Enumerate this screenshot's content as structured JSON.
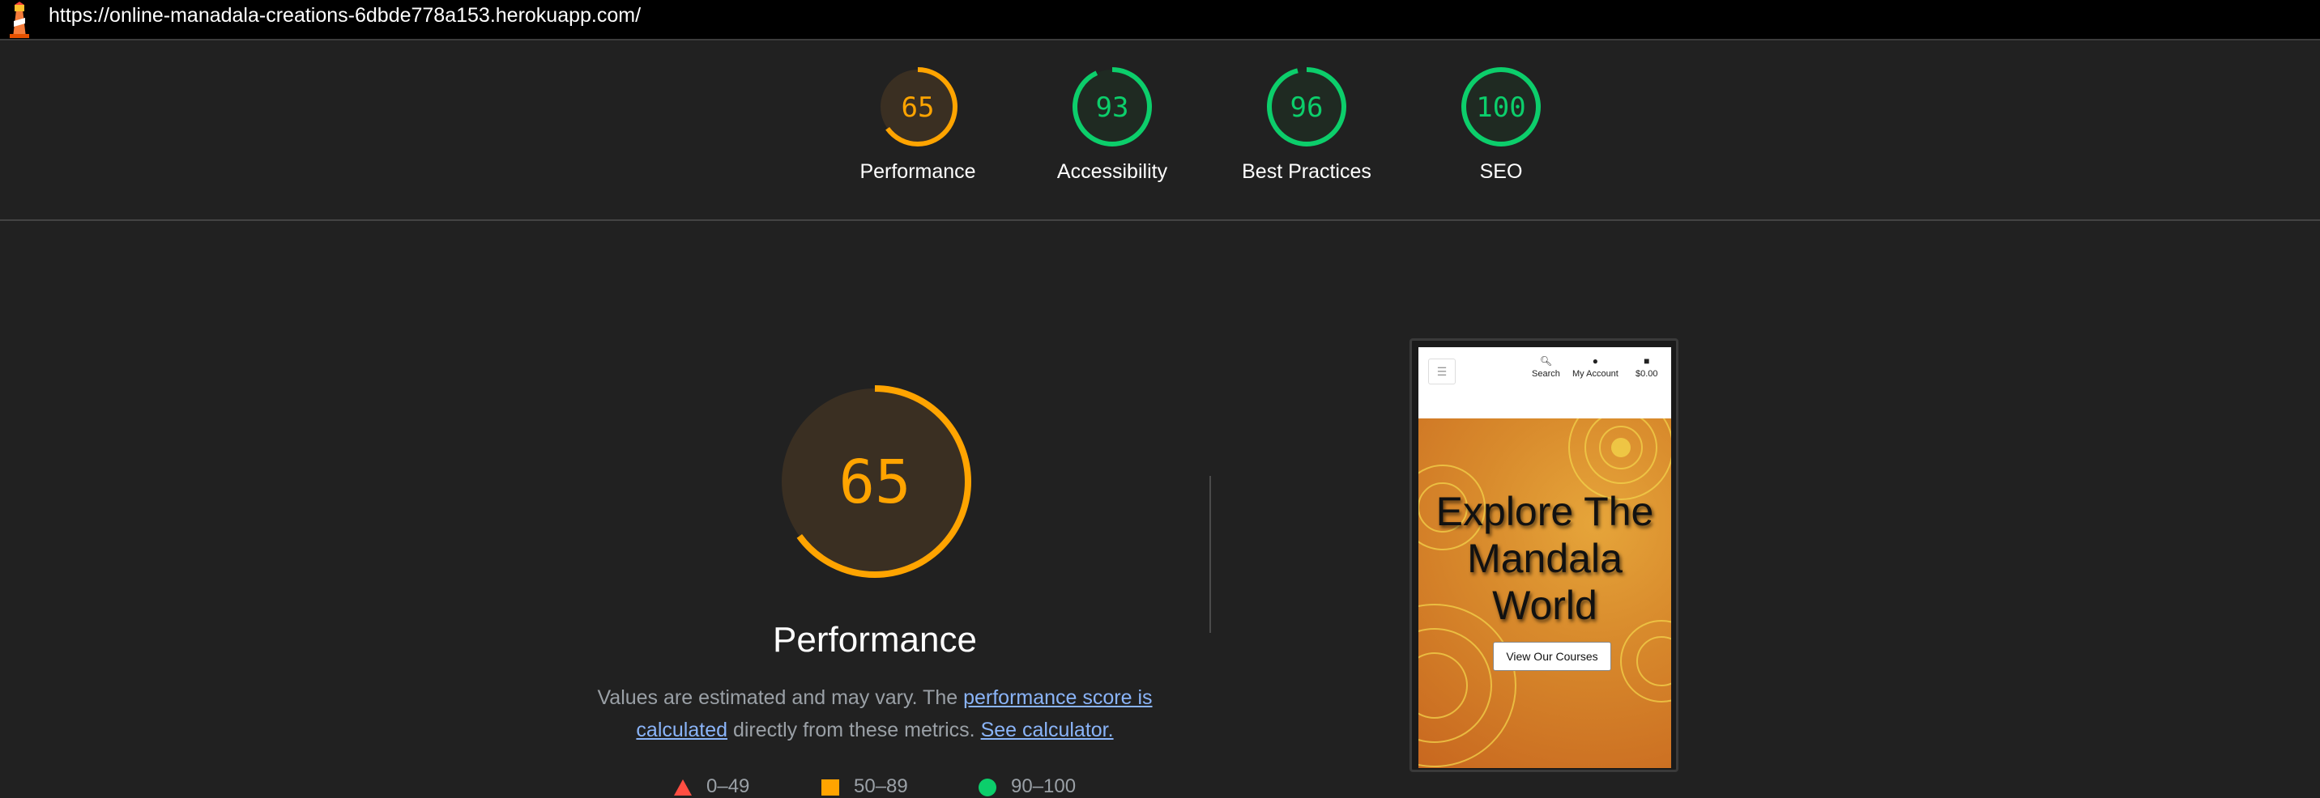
{
  "url_bar": {
    "url": "https://online-manadala-creations-6dbde778a153.herokuapp.com/"
  },
  "colors": {
    "average": "#ffa400",
    "pass": "#0cce6b",
    "fail": "#ff4e42"
  },
  "gauges": [
    {
      "label": "Performance",
      "score": "65",
      "fraction": 0.65,
      "status": "average"
    },
    {
      "label": "Accessibility",
      "score": "93",
      "fraction": 0.93,
      "status": "pass"
    },
    {
      "label": "Best Practices",
      "score": "96",
      "fraction": 0.96,
      "status": "pass"
    },
    {
      "label": "SEO",
      "score": "100",
      "fraction": 1.0,
      "status": "pass"
    }
  ],
  "performance": {
    "score": "65",
    "fraction": 0.65,
    "title": "Performance",
    "desc_prefix": "Values are estimated and may vary. The ",
    "desc_link": "performance score is calculated",
    "desc_middle": " directly from these metrics. ",
    "desc_calc_link": "See calculator.",
    "legend": [
      {
        "range": "0–49",
        "shape": "triangle-icon"
      },
      {
        "range": "50–89",
        "shape": "square-icon"
      },
      {
        "range": "90–100",
        "shape": "circle-icon"
      }
    ]
  },
  "thumbnail": {
    "nav": {
      "search": "Search",
      "account": "My Account",
      "cart": "$0.00"
    },
    "hero_line1": "Explore The",
    "hero_line2": "Mandala",
    "hero_line3": "World",
    "button": "View Our Courses"
  }
}
